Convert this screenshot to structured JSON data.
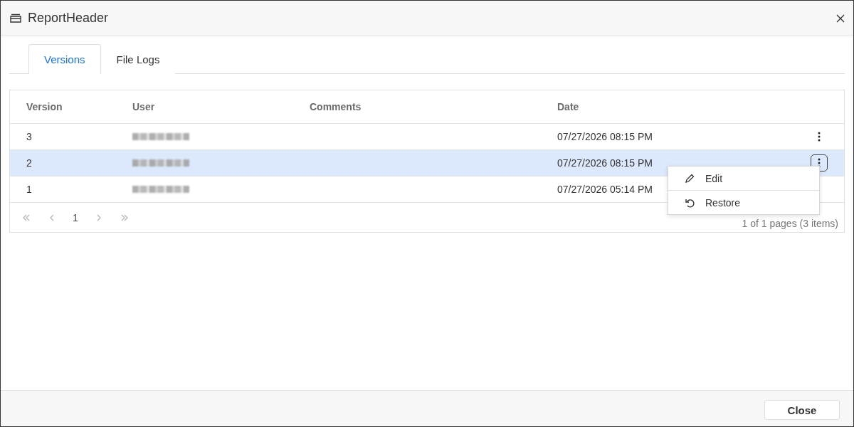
{
  "dialog": {
    "title": "ReportHeader"
  },
  "tabs": [
    {
      "label": "Versions",
      "selected": true
    },
    {
      "label": "File Logs",
      "selected": false
    }
  ],
  "table": {
    "columns": [
      "Version",
      "User",
      "Comments",
      "Date"
    ],
    "rows": [
      {
        "version": "3",
        "date": "07/27/2026 08:15 PM",
        "selected": false
      },
      {
        "version": "2",
        "date": "07/27/2026 08:15 PM",
        "selected": true
      },
      {
        "version": "1",
        "date": "07/27/2026 05:14 PM",
        "selected": false
      }
    ]
  },
  "pager": {
    "page": "1",
    "summary": "1 of 1 pages (3 items)"
  },
  "context_menu": {
    "items": [
      {
        "kind": "edit",
        "label": "Edit"
      },
      {
        "kind": "restore",
        "label": "Restore"
      }
    ]
  },
  "footer": {
    "buttons": [
      "Close"
    ]
  }
}
